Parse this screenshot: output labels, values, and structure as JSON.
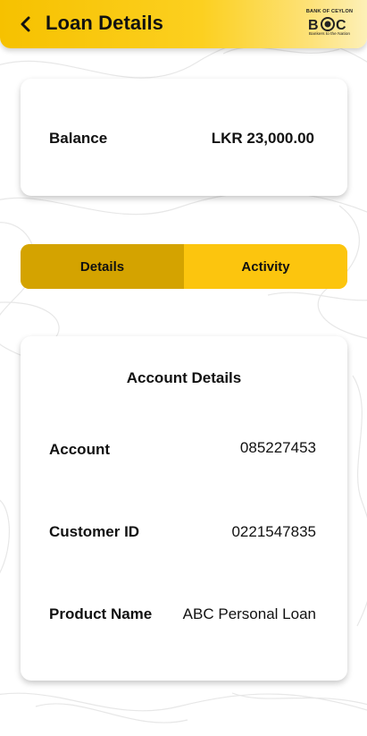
{
  "header": {
    "title": "Loan Details",
    "back_icon": "chevron-left-icon",
    "logo": {
      "top_text": "BANK OF CEYLON",
      "mark_text": "BOC",
      "tagline": "Bankers to the Nation"
    }
  },
  "balance": {
    "label": "Balance",
    "value": "LKR 23,000.00"
  },
  "tabs": [
    {
      "label": "Details",
      "active": true
    },
    {
      "label": "Activity",
      "active": false
    }
  ],
  "account_details": {
    "title": "Account Details",
    "rows": [
      {
        "label": "Account",
        "value": "085227453"
      },
      {
        "label": "Customer ID",
        "value": "0221547835"
      },
      {
        "label": "Product Name",
        "value": "ABC Personal Loan"
      }
    ]
  },
  "colors": {
    "brand_yellow": "#fcc50e",
    "tab_active": "#d4a300",
    "text": "#111111"
  }
}
